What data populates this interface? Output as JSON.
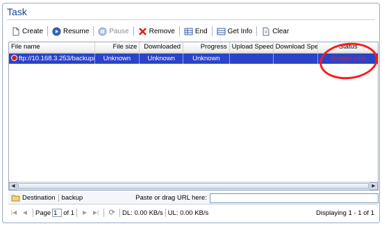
{
  "window": {
    "title": "Task"
  },
  "toolbar": {
    "create": "Create",
    "resume": "Resume",
    "pause": "Pause",
    "remove": "Remove",
    "end": "End",
    "get_info": "Get Info",
    "clear": "Clear"
  },
  "grid": {
    "columns": {
      "file_name": "File name",
      "file_size": "File size",
      "downloaded": "Downloaded",
      "progress": "Progress",
      "upload_speed": "Upload Speed",
      "download_speed": "Download Speed",
      "status": "Status"
    },
    "rows": [
      {
        "file_name": "ftp://10.168.3.253/backup/",
        "file_size": "Unknown",
        "downloaded": "Unknown",
        "progress": "Unknown",
        "upload_speed": "",
        "download_speed": "",
        "status": "Broken Link"
      }
    ]
  },
  "destination": {
    "button_label": "Destination",
    "value": "backup",
    "paste_label": "Paste or drag URL here:",
    "url_value": ""
  },
  "pager": {
    "page_label": "Page",
    "page_value": "1",
    "of_label": "of 1",
    "dl_speed": "DL: 0.00 KB/s",
    "ul_speed": "UL: 0.00 KB/s",
    "displaying": "Displaying 1 - 1 of 1"
  },
  "colors": {
    "title": "#15428b",
    "selected_row": "#2a44c8",
    "status_error": "#e02020",
    "annotation": "#ff1a1a"
  }
}
